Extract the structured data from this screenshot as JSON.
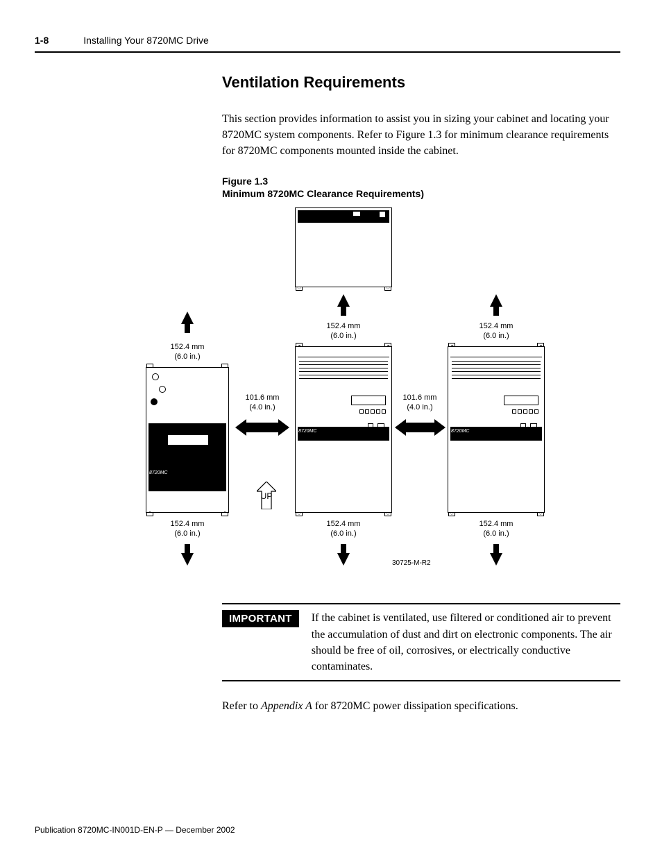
{
  "header": {
    "page_number": "1-8",
    "running_title": "Installing Your 8720MC Drive"
  },
  "section": {
    "title": "Ventilation Requirements",
    "intro": "This section provides information to assist you in sizing your cabinet and locating your 8720MC system components. Refer to Figure 1.3 for minimum clearance requirements for 8720MC components mounted inside the cabinet."
  },
  "figure": {
    "number": "Figure 1.3",
    "title": "Minimum 8720MC Clearance Requirements)",
    "ref": "30725-M-R2",
    "up_label": "UP",
    "product_label": "8720MC",
    "clearances": {
      "top_a_mm": "152.4 mm",
      "top_a_in": "(6.0 in.)",
      "top_b_mm": "152.4 mm",
      "top_b_in": "(6.0 in.)",
      "top_c_mm": "152.4 mm",
      "top_c_in": "(6.0 in.)",
      "side_ab_mm": "101.6 mm",
      "side_ab_in": "(4.0 in.)",
      "side_bc_mm": "101.6 mm",
      "side_bc_in": "(4.0 in.)",
      "bot_a_mm": "152.4 mm",
      "bot_a_in": "(6.0 in.)",
      "bot_b_mm": "152.4 mm",
      "bot_b_in": "(6.0 in.)",
      "bot_c_mm": "152.4 mm",
      "bot_c_in": "(6.0 in.)"
    }
  },
  "important": {
    "badge": "IMPORTANT",
    "text": "If the cabinet is ventilated, use filtered or conditioned air to prevent the accumulation of dust and dirt on electronic components. The air should be free of oil, corrosives, or electrically conductive contaminates."
  },
  "closing": {
    "prefix": "Refer to ",
    "appendix": "Appendix A",
    "suffix": " for 8720MC power dissipation specifications."
  },
  "footer": {
    "pub": "Publication 8720MC-IN001D-EN-P — December 2002"
  }
}
